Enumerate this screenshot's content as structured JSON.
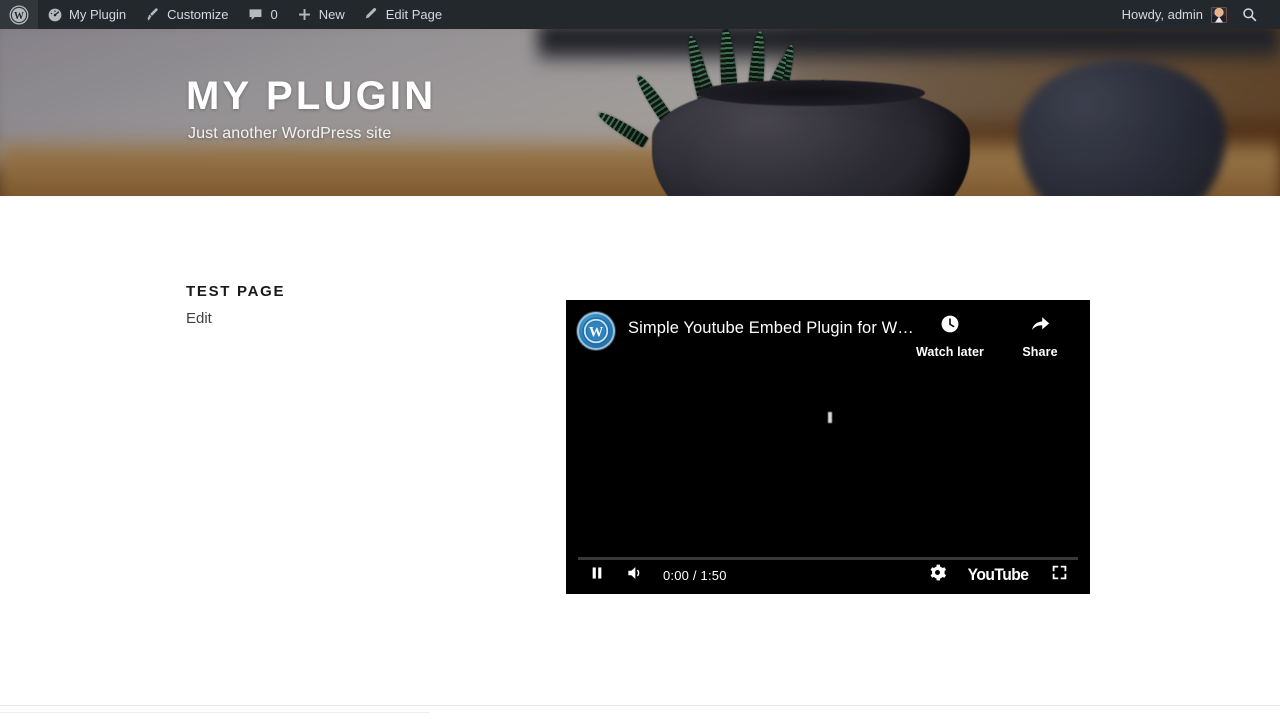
{
  "admin_bar": {
    "wp_logo": "wordpress-logo-icon",
    "site_name": "My Plugin",
    "site_icon": "dashboard-gauge-icon",
    "customize": "Customize",
    "customize_icon": "paintbrush-icon",
    "comments_icon": "comment-bubble-icon",
    "comments_count": "0",
    "new_icon": "plus-icon",
    "new_label": "New",
    "edit_page_icon": "pencil-icon",
    "edit_page_label": "Edit Page",
    "howdy": "Howdy, admin",
    "avatar": "user-avatar",
    "search_icon": "search-icon",
    "background": "#23282d"
  },
  "hero": {
    "site_title": "MY PLUGIN",
    "site_description": "Just another WordPress site",
    "image_alt": "blurred potted zebra succulent on a wooden desk"
  },
  "content": {
    "entry_title": "TEST PAGE",
    "edit_link": "Edit"
  },
  "video": {
    "channel_avatar": "wordpress-logo-icon",
    "title": "Simple Youtube Embed Plugin for W…",
    "watch_later_icon": "clock-icon",
    "watch_later_label": "Watch later",
    "share_icon": "share-arrow-icon",
    "share_label": "Share",
    "pause_icon": "pause-icon",
    "volume_icon": "volume-on-icon",
    "current_time": "0:00",
    "duration": "1:50",
    "time_display": "0:00 / 1:50",
    "settings_icon": "gear-icon",
    "logo_text": "YouTube",
    "fullscreen_icon": "fullscreen-icon",
    "progress_percent": 0,
    "accent_color": "#ff0000"
  }
}
